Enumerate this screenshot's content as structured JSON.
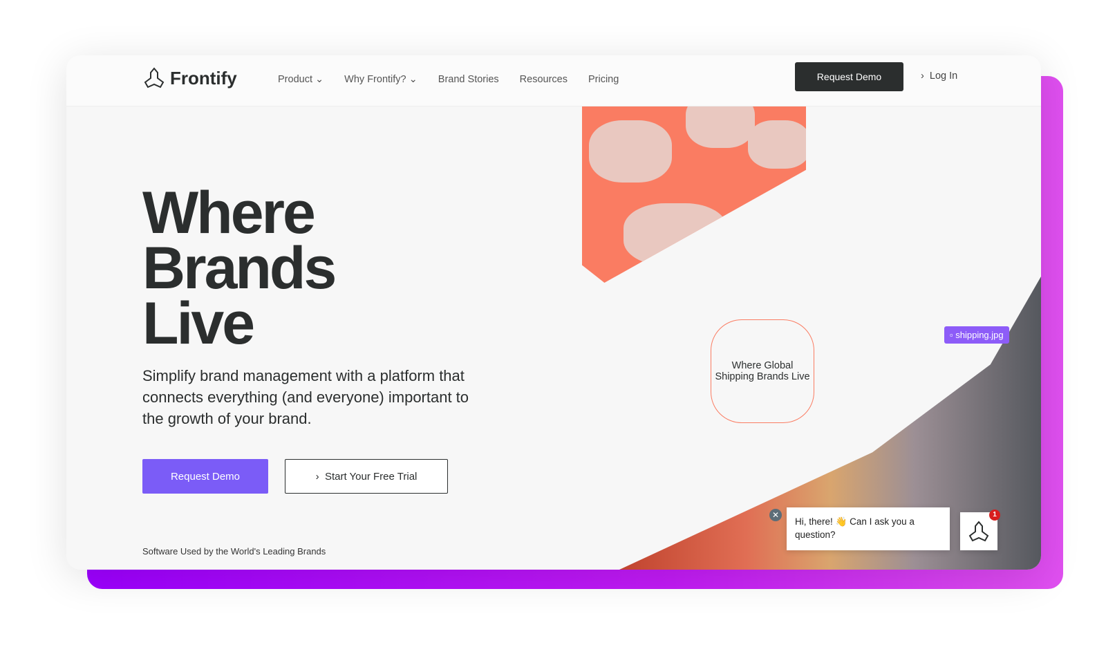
{
  "brand": "Frontify",
  "nav": {
    "items": [
      {
        "label": "Product",
        "dropdown": true
      },
      {
        "label": "Why Frontify?",
        "dropdown": true
      },
      {
        "label": "Brand Stories"
      },
      {
        "label": "Resources"
      },
      {
        "label": "Pricing"
      }
    ],
    "request_demo": "Request Demo",
    "login": "Log In"
  },
  "hero": {
    "title_1": "Where",
    "title_2": "Brands",
    "title_3": "Live",
    "subtitle": "Simplify brand management with a platform that connects everything (and everyone) important to the growth of your brand.",
    "primary_cta": "Request Demo",
    "secondary_cta": "Start Your Free Trial",
    "footer": "Software Used by the World's Leading Brands"
  },
  "visual": {
    "hex_label": "Where Global Shipping Brands Live",
    "file_tag": "shipping.jpg"
  },
  "chat": {
    "message": "Hi, there! 👋  Can I ask you a question?",
    "badge": "1"
  },
  "colors": {
    "accent": "#7b5cf7",
    "dark": "#2b2e2e",
    "orange": "#fa7c62",
    "frame": "#b000ff"
  }
}
